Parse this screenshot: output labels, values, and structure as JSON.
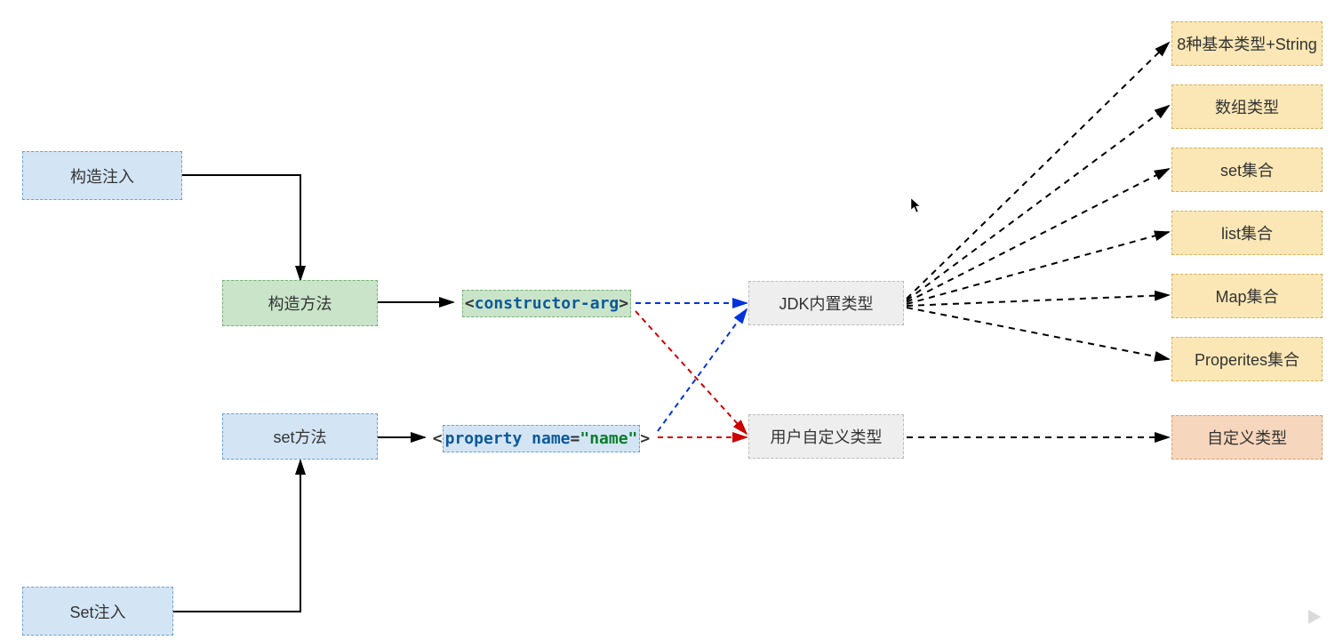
{
  "nodes": {
    "constructorInjection": "构造注入",
    "setInjection": "Set注入",
    "constructorMethod": "构造方法",
    "setMethod": "set方法",
    "jdkBuiltin": "JDK内置类型",
    "userDefined": "用户自定义类型",
    "basicTypes": "8种基本类型+String",
    "arrayType": "数组类型",
    "setCollection": "set集合",
    "listCollection": "list集合",
    "mapCollection": "Map集合",
    "propertiesCollection": "Properites集合",
    "customType": "自定义类型"
  },
  "code": {
    "constructorArg": {
      "open": "<",
      "tag": "constructor-arg",
      "close": ">"
    },
    "property": {
      "open": "<",
      "tag": "property",
      "sp": " ",
      "attr": "name",
      "eq": "=",
      "val": "\"name\"",
      "close": ">"
    }
  },
  "colors": {
    "arrowBlack": "#000",
    "arrowBlue": "#0033dd",
    "arrowRed": "#cc0000"
  }
}
